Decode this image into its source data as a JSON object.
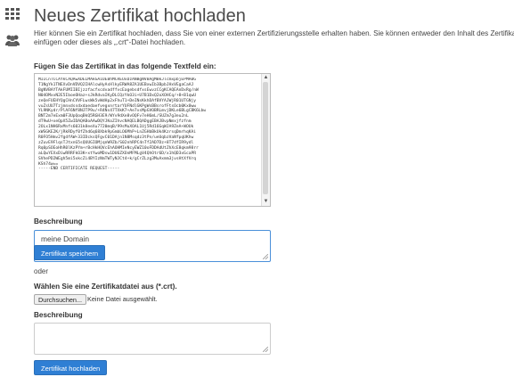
{
  "sidebar": {
    "icons": [
      "grid-icon",
      "users-icon"
    ]
  },
  "page": {
    "title": "Neues Zertifikat hochladen",
    "description": "Hier können Sie ein Zertifikat hochladen, dass Sie von einer externen Zertifizierungsstelle erhalten haben. Sie können entweder den Inhalt des Zertifikats einfügen oder dieses als „.crt“-Datei hochladen."
  },
  "paste_section": {
    "label": "Fügen Sie das Zertifikat in das folgende Textfeld ein:",
    "certificate_text": "MIICnTCCAYkCAQAwXDELMAkGA1UEBhMCREUxDzANBgNVBAgMBkJlcmxpbjEPMA0G\nT1NgYk1TNEXvDnVDVQ2IHAlcwHyAsHlkyERWA8ZA1UEBxwIb3BpbJHxVEgaCaAJ\nBgNVBAYTAkFUMIIBIjzzfacfxcdvadffvcEagebsdfxsEwvzCCgKCAQEAnDxRg/nW\nN04OMxvN2E5IboeOHaz+sJkRdvaIKyDLCQzYkO3i+U7B1DxQ2oXOHCq/+8+B1qwU\nzeQeFUEHYQgCHnCVVFLwsWk5vWdHp2xFhuT1+DeINsKkhDAfBVYAJWjR01UTGNjy\nvuZsUU7TzjmnxdssdxdaedaefvegxnrtarYUFNdlGKPgWsBBsrofFtsOcb0Kx0ww\nYL9NKydr/PlAF6Nf8NJTP9u/+R4Ns47TXkK7+Ae7vsMpGVOBRLmvjDKLe6BLgCBK6Lbw\nBNT2m7eExm0F3UpQoqBkQ5RGH3E9/WYv9dXe8vOQFv7eH6mL/SUZm7g3eu2nL\ndT9wU+xeQpX5ZwIDAQABoAAwDQYJKoZIhvcNAQELBQADggEBAJBvpNmxjfzfnm\n2OLx1NH6RxMnfs6031k8eeXu7720mqB/99sMuXOAL1Uj5Rd16GqWJA9ZeA+WOUk\nxWSGKE2K/jRkRDyf0fZhd6q68Xbk9pGmbLO6MhP+LnZGHbBkUk4KzrsqDmrhqKAi\nR0FO5Hmv2fgdfAW+33IDcksQFgvC01DAjn1N8Msqdz3tPn/ueUqbzVaNfpqUKhw\nzZuvE9FlqsTJtxnG5sQUUGIOMjqnW9Zb/S02nhRPC4nTf2AD7Dz+8T7dfIR9ydl\nRq0pSOEoHhR0lKzPYm+rBcHkHQVcEhAOHMIeNcyEWZ10oFDDAdUtZhXcE8qkm98rr\naLQwYEXxDiwRRRFkO3K+xtYwoMDsw1DU6ZXOnMFMLgV4QhOtr6D/x1hQD3xGcaPR\nSVhePD2WEgh5mi5xkcZi4BYIzNmTWTyNJCt4+k/gCrZLzg3MuAxmm3jvsHtXfVrq\nKSh74w==\n-----END CERTIFICATE REQUEST-----"
  },
  "description_field": {
    "label": "Beschreibung",
    "value": "meine Domain"
  },
  "save_button": {
    "label": "Zertifikat speichern"
  },
  "or_text": "oder",
  "file_section": {
    "label": "Wählen Sie eine Zertifikatdatei aus (*.crt).",
    "browse_label": "Durchsuchen...",
    "no_file_label": "Keine Datei ausgewählt."
  },
  "description_field_2": {
    "label": "Beschreibung",
    "value": ""
  },
  "upload_button": {
    "label": "Zertifikat hochladen"
  },
  "colors": {
    "accent": "#2f7fd4",
    "focus_border": "#4a90d9"
  }
}
